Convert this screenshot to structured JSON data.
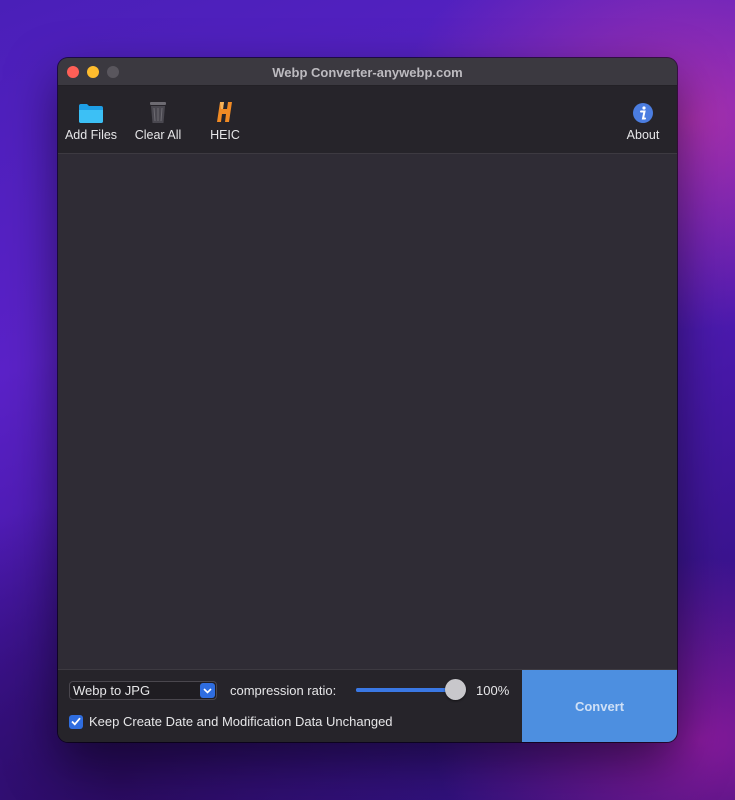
{
  "window": {
    "title": "Webp Converter-anywebp.com"
  },
  "toolbar": {
    "items": [
      {
        "label": "Add Files",
        "icon": "folder-icon"
      },
      {
        "label": "Clear All",
        "icon": "trash-icon"
      },
      {
        "label": "HEIC",
        "icon": "heic-icon"
      },
      {
        "label": "About",
        "icon": "info-icon"
      }
    ]
  },
  "bottom": {
    "format_select": {
      "selected": "Webp to JPG"
    },
    "compression_label": "compression ratio:",
    "compression_value": 1.0,
    "compression_text": "100%",
    "keep_dates_checked": true,
    "keep_dates_label": "Keep Create Date and Modification Data Unchanged",
    "convert_label": "Convert"
  },
  "colors": {
    "accent": "#2f6ddf",
    "convert_button": "#4d8fe0",
    "window_bg": "#2f2c35"
  }
}
